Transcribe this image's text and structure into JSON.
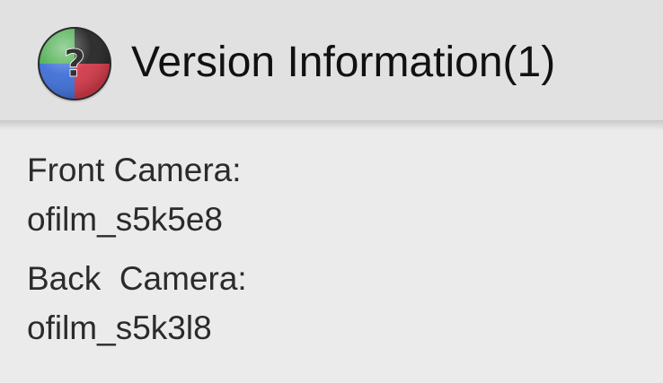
{
  "header": {
    "title": "Version Information(1)",
    "icon": "help-question-icon",
    "icon_colors": {
      "top_left": "#4caf50",
      "top_right": "#252525",
      "bottom_left": "#3f6fd6",
      "bottom_right": "#d23a4a",
      "question_mark": "#333333"
    }
  },
  "info": {
    "items": [
      {
        "label": "Front Camera:",
        "value": "ofilm_s5k5e8"
      },
      {
        "label": "Back  Camera:",
        "value": "ofilm_s5k3l8"
      }
    ]
  },
  "colors": {
    "header_background": "#e1e1e1",
    "page_background": "#ebebeb",
    "text": "#2b2b2b"
  }
}
